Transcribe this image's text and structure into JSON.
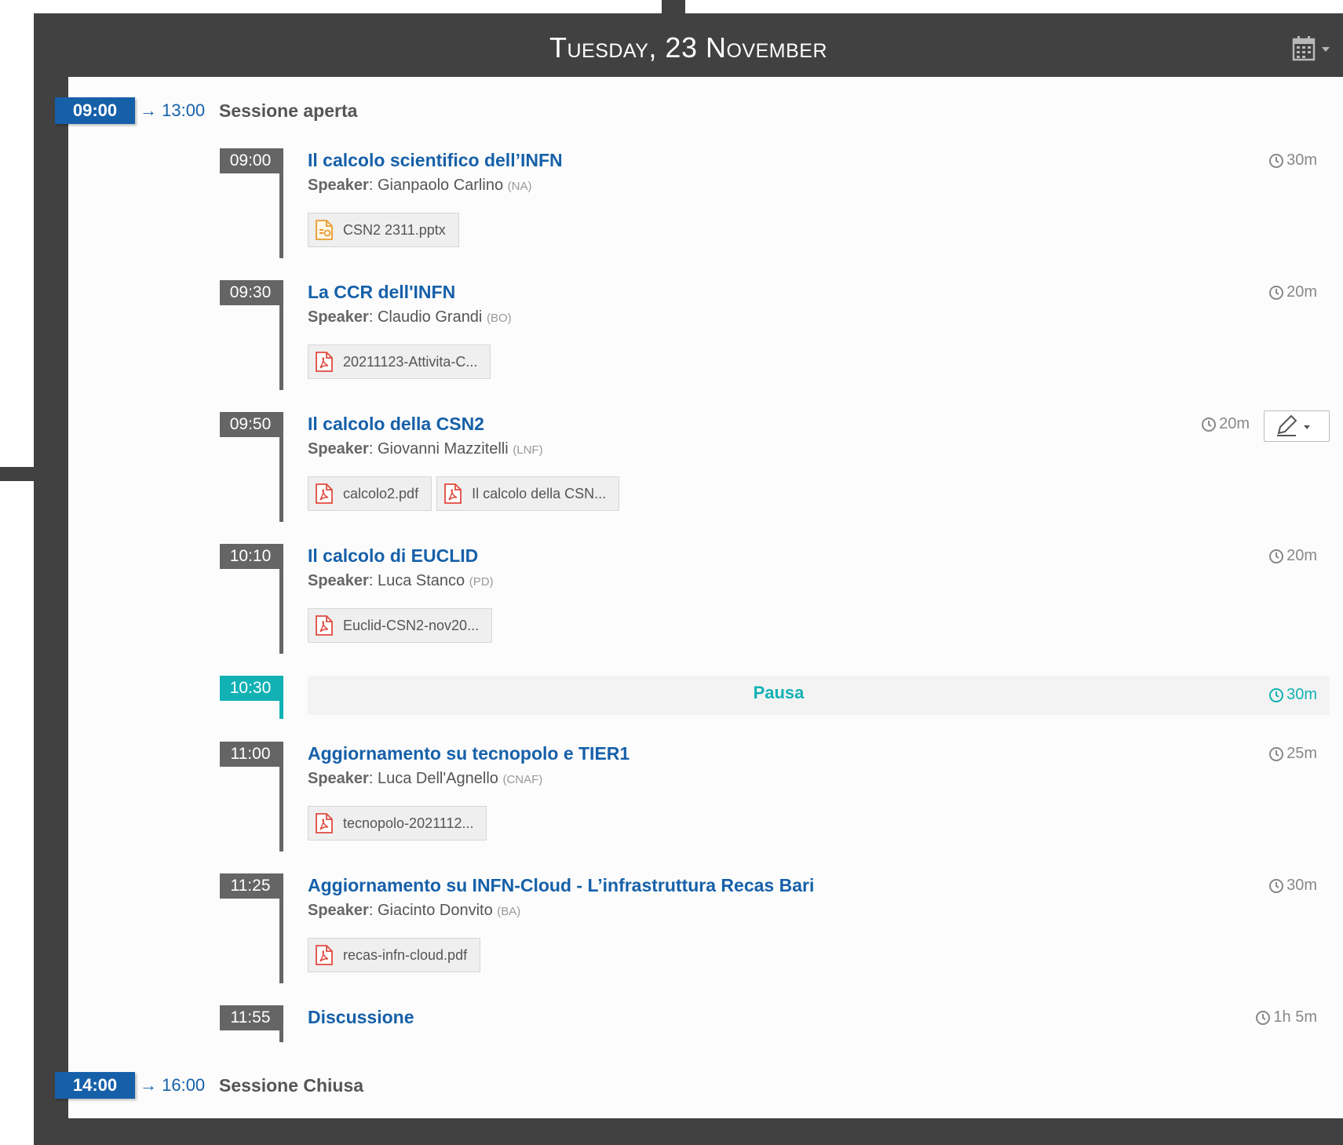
{
  "day_title": "Tuesday, 23 November",
  "colors": {
    "frame": "#414141",
    "session_blue": "#1660a9",
    "break_teal": "#12b1b4",
    "time_gray": "#656565",
    "pdf_red": "#e04a3f",
    "pptx_orange": "#e89b2e"
  },
  "icons": {
    "calendar": "calendar-icon",
    "clock": "clock-icon",
    "pdf": "pdf-file-icon",
    "pptx": "pptx-file-icon",
    "edit": "pencil-icon"
  },
  "sessions": [
    {
      "start": "09:00",
      "end": "→ 13:00",
      "title": "Sessione aperta"
    },
    {
      "start": "14:00",
      "end": "→ 16:00",
      "title": "Sessione Chiusa"
    }
  ],
  "contributions": [
    {
      "time": "09:00",
      "title": "Il calcolo scientifico dell’INFN",
      "speaker_label": "Speaker",
      "speaker": "Gianpaolo Carlino",
      "affiliation": "(NA)",
      "duration": "30m",
      "attachments": [
        {
          "type": "pptx",
          "name": "CSN2 2311.pptx"
        }
      ]
    },
    {
      "time": "09:30",
      "title": "La CCR dell'INFN",
      "speaker_label": "Speaker",
      "speaker": "Claudio Grandi",
      "affiliation": "(BO)",
      "duration": "20m",
      "attachments": [
        {
          "type": "pdf",
          "name": "20211123-Attivita-C..."
        }
      ]
    },
    {
      "time": "09:50",
      "title": "Il calcolo della CSN2",
      "speaker_label": "Speaker",
      "speaker": "Giovanni Mazzitelli",
      "affiliation": "(LNF)",
      "duration": "20m",
      "attachments": [
        {
          "type": "pdf",
          "name": "calcolo2.pdf"
        },
        {
          "type": "pdf",
          "name": "Il calcolo della CSN..."
        }
      ]
    },
    {
      "time": "10:10",
      "title": "Il calcolo di EUCLID",
      "speaker_label": "Speaker",
      "speaker": "Luca Stanco",
      "affiliation": "(PD)",
      "duration": "20m",
      "attachments": [
        {
          "type": "pdf",
          "name": "Euclid-CSN2-nov20..."
        }
      ]
    },
    {
      "time": "11:00",
      "title": "Aggiornamento su tecnopolo e TIER1",
      "speaker_label": "Speaker",
      "speaker": "Luca Dell'Agnello",
      "affiliation": "(CNAF)",
      "duration": "25m",
      "attachments": [
        {
          "type": "pdf",
          "name": "tecnopolo-2021112..."
        }
      ]
    },
    {
      "time": "11:25",
      "title": "Aggiornamento su INFN-Cloud - L’infrastruttura Recas Bari",
      "speaker_label": "Speaker",
      "speaker": "Giacinto Donvito",
      "affiliation": "(BA)",
      "duration": "30m",
      "attachments": [
        {
          "type": "pdf",
          "name": "recas-infn-cloud.pdf"
        }
      ]
    },
    {
      "time": "11:55",
      "title": "Discussione",
      "duration": "1h 5m"
    }
  ],
  "break": {
    "time": "10:30",
    "title": "Pausa",
    "duration": "30m"
  }
}
